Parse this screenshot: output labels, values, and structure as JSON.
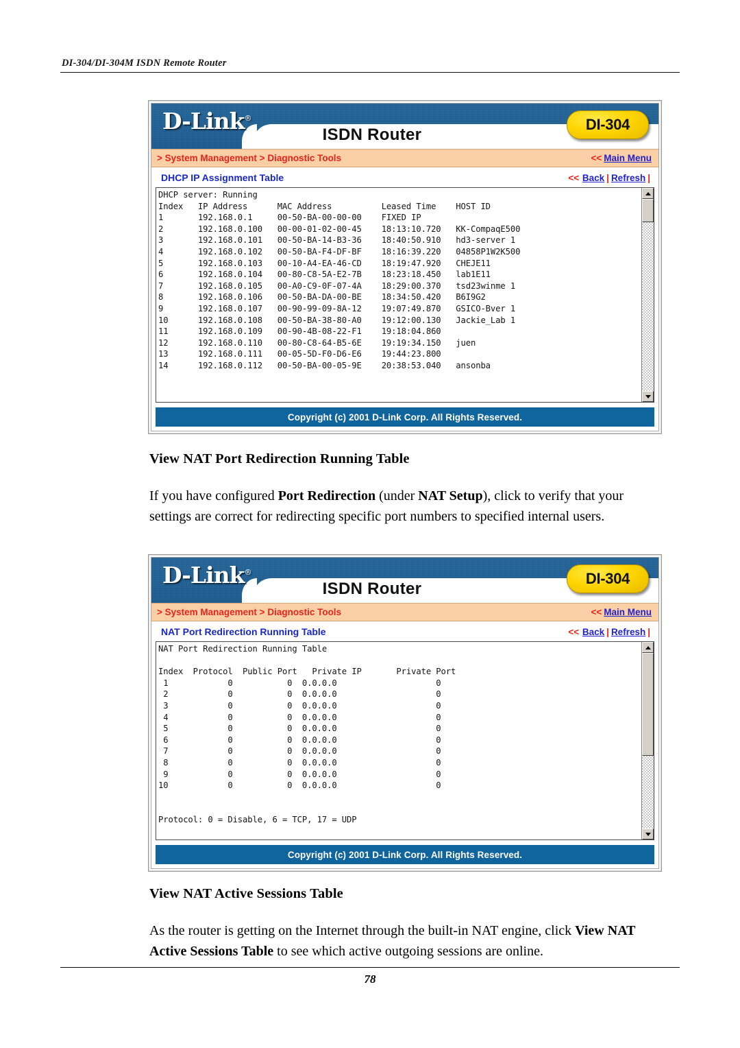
{
  "running_header": {
    "text": "DI-304/DI-304M ISDN Remote Router"
  },
  "panel1": {
    "brand": "D-Link",
    "brand_reg": "®",
    "product_title": "ISDN Router",
    "model_badge": "DI-304",
    "breadcrumb": "> System Management > Diagnostic Tools",
    "main_menu_chevrons": "<<",
    "main_menu_label": "Main Menu",
    "sub_title": "DHCP IP Assignment Table",
    "back_chevrons": "<<",
    "back_label": "Back",
    "separator": "|",
    "refresh_label": "Refresh",
    "trailing_pipe": "|",
    "copyright": "Copyright (c) 2001 D-Link Corp. All Rights Reserved.",
    "terminal": "DHCP server: Running\nIndex   IP Address      MAC Address          Leased Time    HOST ID\n1       192.168.0.1     00-50-BA-00-00-00    FIXED IP\n2       192.168.0.100   00-00-01-02-00-45    18:13:10.720   KK-CompaqE500\n3       192.168.0.101   00-50-BA-14-B3-36    18:40:50.910   hd3-server 1\n4       192.168.0.102   00-50-BA-F4-DF-BF    18:16:39.220   04858P1W2K500\n5       192.168.0.103   00-10-A4-EA-46-CD    18:19:47.920   CHEJE11\n6       192.168.0.104   00-80-C8-5A-E2-7B    18:23:18.450   lab1E11\n7       192.168.0.105   00-A0-C9-0F-07-4A    18:29:00.370   tsd23winme 1\n8       192.168.0.106   00-50-BA-DA-00-BE    18:34:50.420   B6I9G2\n9       192.168.0.107   00-90-99-09-8A-12    19:07:49.870   GSICO-Bver 1\n10      192.168.0.108   00-50-BA-38-80-A0    19:12:00.130   Jackie_Lab 1\n11      192.168.0.109   00-90-4B-08-22-F1    19:18:04.860\n12      192.168.0.110   00-80-C8-64-B5-6E    19:19:34.150   juen\n13      192.168.0.111   00-05-5D-F0-D6-E6    19:44:23.800\n14      192.168.0.112   00-50-BA-00-05-9E    20:38:53.040   ansonba"
  },
  "panel2": {
    "brand": "D-Link",
    "brand_reg": "®",
    "product_title": "ISDN Router",
    "model_badge": "DI-304",
    "breadcrumb": "> System Management > Diagnostic Tools",
    "main_menu_chevrons": "<<",
    "main_menu_label": "Main Menu",
    "sub_title": "NAT Port Redirection Running Table",
    "back_chevrons": "<<",
    "back_label": "Back",
    "separator": "|",
    "refresh_label": "Refresh",
    "trailing_pipe": "|",
    "copyright": "Copyright (c) 2001 D-Link Corp. All Rights Reserved.",
    "terminal": "NAT Port Redirection Running Table\n\nIndex  Protocol  Public Port   Private IP       Private Port\n 1            0           0  0.0.0.0                    0\n 2            0           0  0.0.0.0                    0\n 3            0           0  0.0.0.0                    0\n 4            0           0  0.0.0.0                    0\n 5            0           0  0.0.0.0                    0\n 6            0           0  0.0.0.0                    0\n 7            0           0  0.0.0.0                    0\n 8            0           0  0.0.0.0                    0\n 9            0           0  0.0.0.0                    0\n10            0           0  0.0.0.0                    0\n\n\nProtocol: 0 = Disable, 6 = TCP, 17 = UDP"
  },
  "section1": {
    "heading": "View NAT Port Redirection Running Table",
    "para_part1": "If you have configured ",
    "para_bold1": "Port Redirection",
    "para_part2": " (under ",
    "para_bold2": "NAT Setup",
    "para_part3": "), click to verify that your settings are correct for redirecting specific port numbers to specified internal users."
  },
  "section2": {
    "heading": "View NAT Active Sessions Table",
    "para_part1": "As the router is getting on the Internet through the built-in NAT engine, click ",
    "para_bold1": "View NAT Active Sessions Table",
    "para_part2": " to see which active outgoing sessions are online."
  },
  "footer": {
    "page_number": "78"
  }
}
